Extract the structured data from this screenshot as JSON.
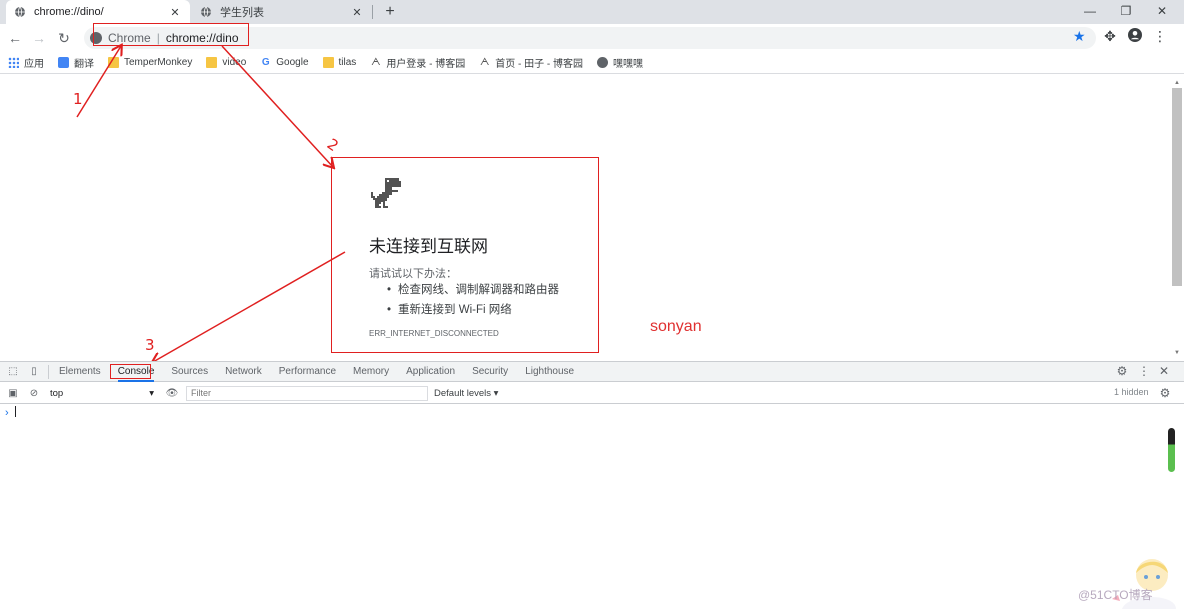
{
  "browser": {
    "tabs": [
      {
        "title": "chrome://dino/",
        "active": true
      },
      {
        "title": "学生列表",
        "active": false
      }
    ],
    "window_controls": [
      "—",
      "❐",
      "✕"
    ],
    "omnibox": {
      "origin": "Chrome",
      "separator": "|",
      "url": "chrome://dino"
    },
    "bookmarks": [
      {
        "label": "应用",
        "icon": "apps-icon"
      },
      {
        "label": "翻译",
        "icon": "translate-icon"
      },
      {
        "label": "TemperMonkey",
        "icon": "folder-icon"
      },
      {
        "label": "video",
        "icon": "folder-icon"
      },
      {
        "label": "Google",
        "icon": "google-icon"
      },
      {
        "label": "tilas",
        "icon": "folder-icon"
      },
      {
        "label": "用户登录 - 博客园",
        "icon": "cnblogs-icon"
      },
      {
        "label": "首页 - 田子 - 博客园",
        "icon": "cnblogs-icon"
      },
      {
        "label": "嘿嘿嘿",
        "icon": "globe-icon"
      }
    ]
  },
  "page": {
    "error_title": "未连接到互联网",
    "try_label": "请试试以下办法：",
    "suggestions": [
      "检查网线、调制解调器和路由器",
      "重新连接到 Wi-Fi 网络"
    ],
    "error_code": "ERR_INTERNET_DISCONNECTED",
    "watermark": "sonyan"
  },
  "annotations": {
    "labels": [
      "1",
      "2",
      "3"
    ],
    "color": "#e02020"
  },
  "devtools": {
    "tabs": [
      "Elements",
      "Console",
      "Sources",
      "Network",
      "Performance",
      "Memory",
      "Application",
      "Security",
      "Lighthouse"
    ],
    "active_tab": "Console",
    "context": "top",
    "filter_placeholder": "Filter",
    "levels": "Default levels ▾",
    "hidden_count": "1 hidden",
    "prompt": "›"
  },
  "footer_watermark": "@51CTO博客"
}
